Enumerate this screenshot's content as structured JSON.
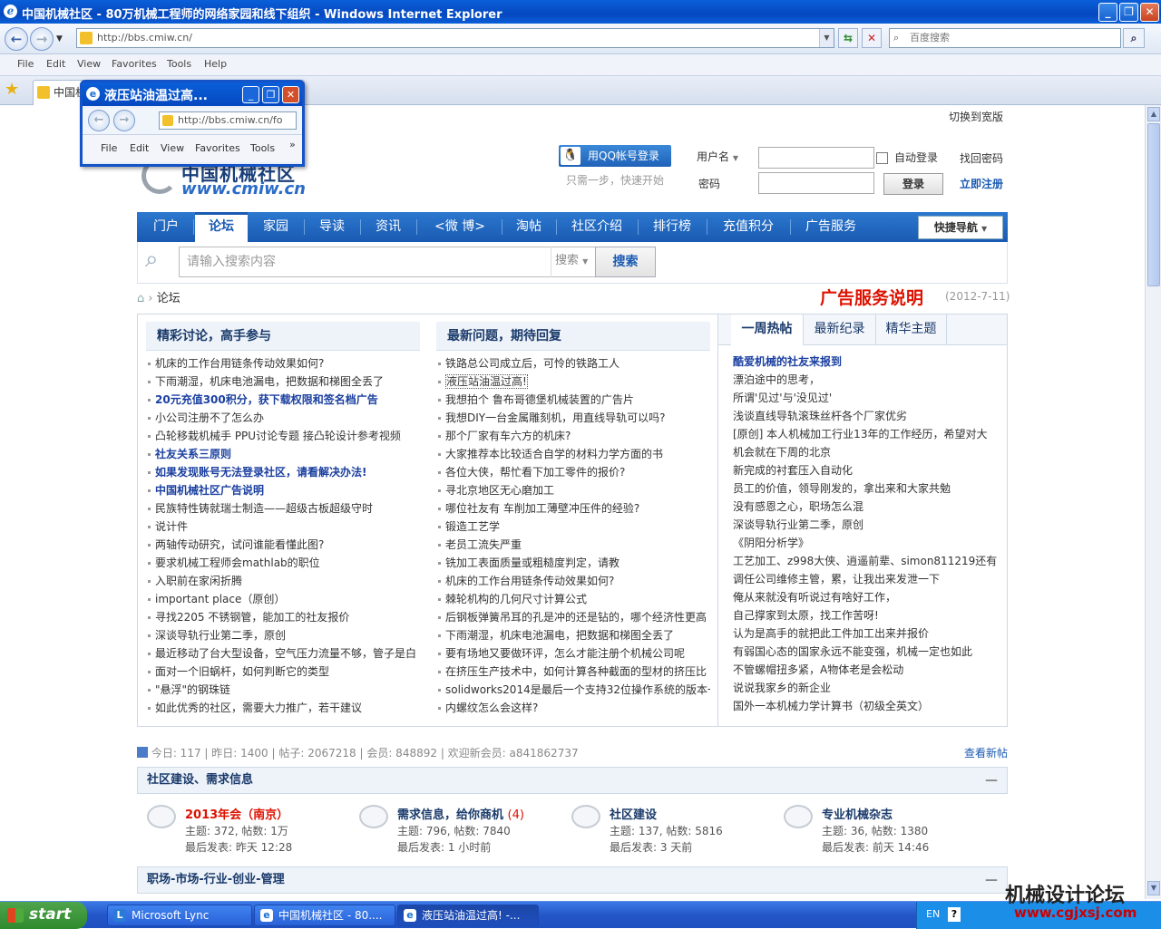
{
  "window": {
    "title": "中国机械社区 - 80万机械工程师的网络家园和线下组织 - Windows Internet Explorer"
  },
  "browser": {
    "address": "http://bbs.cmiw.cn/",
    "search_placeholder": "百度搜索",
    "menu": [
      "File",
      "Edit",
      "View",
      "Favorites",
      "Tools",
      "Help"
    ],
    "tab_label": "中国机"
  },
  "popup": {
    "title": "液压站油温过高...",
    "address": "http://bbs.cmiw.cn/fo",
    "menu": [
      "File",
      "Edit",
      "View",
      "Favorites",
      "Tools"
    ],
    "more": "»"
  },
  "site": {
    "wide_switch": "切换到宽版",
    "logo_cn": "中国机械社区",
    "logo_url": "www.cmiw.cn",
    "qq_login": "用QQ帐号登录",
    "qq_hint": "只需一步，快速开始",
    "username_label": "用户名",
    "password_label": "密码",
    "auto_login": "自动登录",
    "forgot": "找回密码",
    "login_btn": "登录",
    "register": "立即注册",
    "nav": [
      "门户",
      "论坛",
      "家园",
      "导读",
      "资讯",
      "<微 博>",
      "淘帖",
      "社区介绍",
      "排行榜",
      "充值积分",
      "广告服务"
    ],
    "quick_nav": "快捷导航",
    "search_placeholder": "请输入搜索内容",
    "search_type": "搜索",
    "search_btn": "搜索",
    "breadcrumb": "论坛",
    "ad_title": "广告服务说明",
    "ad_date": "(2012-7-11)"
  },
  "col1": {
    "title": "精彩讨论，高手参与",
    "items": [
      {
        "t": "机床的工作台用链条传动效果如何?",
        "b": false
      },
      {
        "t": "下雨潮湿，机床电池漏电，把数据和梯图全丢了",
        "b": false
      },
      {
        "t": "20元充值300积分，获下载权限和签名档广告",
        "b": true
      },
      {
        "t": "小公司注册不了怎么办",
        "b": false
      },
      {
        "t": "凸轮移栽机械手 PPU讨论专题 接凸轮设计参考视频",
        "b": false
      },
      {
        "t": "社友关系三原则",
        "b": true
      },
      {
        "t": "如果发现账号无法登录社区，请看解决办法!",
        "b": true
      },
      {
        "t": "中国机械社区广告说明",
        "b": true
      },
      {
        "t": "民族特性铸就瑞士制造——超级古板超级守时",
        "b": false
      },
      {
        "t": "说计件",
        "b": false
      },
      {
        "t": "两轴传动研究，试问谁能看懂此图?",
        "b": false
      },
      {
        "t": "要求机械工程师会mathlab的职位",
        "b": false
      },
      {
        "t": "入职前在家闲折腾",
        "b": false
      },
      {
        "t": "important place（原创）",
        "b": false
      },
      {
        "t": "寻找2205 不锈钢管，能加工的社友报价",
        "b": false
      },
      {
        "t": "深谈导轨行业第二季，原创",
        "b": false
      },
      {
        "t": "最近移动了台大型设备，空气压力流量不够，管子是白",
        "b": false
      },
      {
        "t": "面对一个旧蜗杆，如何判断它的类型",
        "b": false
      },
      {
        "t": "\"悬浮\"的钢珠链",
        "b": false
      },
      {
        "t": "如此优秀的社区，需要大力推广，若干建议",
        "b": false
      }
    ]
  },
  "col2": {
    "title": "最新问题，期待回复",
    "items": [
      {
        "t": "铁路总公司成立后，可怜的铁路工人",
        "u": false
      },
      {
        "t": "液压站油温过高!",
        "u": true
      },
      {
        "t": "我想拍个 鲁布哥德堡机械装置的广告片",
        "u": false
      },
      {
        "t": "我想DIY一台金属雕刻机，用直线导轨可以吗?",
        "u": false
      },
      {
        "t": "那个厂家有车六方的机床?",
        "u": false
      },
      {
        "t": "大家推荐本比较适合自学的材料力学方面的书",
        "u": false
      },
      {
        "t": "各位大侠，帮忙看下加工零件的报价?",
        "u": false
      },
      {
        "t": "寻北京地区无心磨加工",
        "u": false
      },
      {
        "t": "哪位社友有 车削加工薄壁冲压件的经验?",
        "u": false
      },
      {
        "t": "锻造工艺学",
        "u": false
      },
      {
        "t": "老员工流失严重",
        "u": false
      },
      {
        "t": "铣加工表面质量或粗糙度判定，请教",
        "u": false
      },
      {
        "t": "机床的工作台用链条传动效果如何?",
        "u": false
      },
      {
        "t": "棘轮机构的几何尺寸计算公式",
        "u": false
      },
      {
        "t": "后钢板弹簧吊耳的孔是冲的还是钻的，哪个经济性更高",
        "u": false
      },
      {
        "t": "下雨潮湿，机床电池漏电，把数据和梯图全丢了",
        "u": false
      },
      {
        "t": "要有场地又要做环评，怎么才能注册个机械公司呢",
        "u": false
      },
      {
        "t": "在挤压生产技术中，如何计算各种截面的型材的挤压比",
        "u": false
      },
      {
        "t": "solidworks2014是最后一个支持32位操作系统的版本一",
        "u": false
      },
      {
        "t": "内螺纹怎么会这样?",
        "u": false
      }
    ]
  },
  "right": {
    "tabs": [
      "一周热帖",
      "最新纪录",
      "精华主题"
    ],
    "items": [
      {
        "t": "酷爱机械的社友来报到",
        "b": true
      },
      {
        "t": "漂泊途中的思考，",
        "b": false
      },
      {
        "t": "所谓'见过'与'没见过'",
        "b": false
      },
      {
        "t": "浅谈直线导轨滚珠丝杆各个厂家优劣",
        "b": false
      },
      {
        "t": "[原创] 本人机械加工行业13年的工作经历，希望对大",
        "b": false
      },
      {
        "t": "机会就在下周的北京",
        "b": false
      },
      {
        "t": "新完成的衬套压入自动化",
        "b": false
      },
      {
        "t": "员工的价值，领导刚发的，拿出来和大家共勉",
        "b": false
      },
      {
        "t": "没有感恩之心，职场怎么混",
        "b": false
      },
      {
        "t": "深谈导轨行业第二季，原创",
        "b": false
      },
      {
        "t": "《阴阳分析学》",
        "b": false
      },
      {
        "t": "工艺加工、z998大侠、逍遥前辈、simon811219还有",
        "b": false
      },
      {
        "t": "调任公司维修主管，累，让我出来发泄一下",
        "b": false
      },
      {
        "t": "俺从来就没有听说过有啥好工作，",
        "b": false
      },
      {
        "t": "自己撑家到太原，找工作苦呀!",
        "b": false
      },
      {
        "t": "认为是高手的就把此工件加工出来并报价",
        "b": false
      },
      {
        "t": "有弱国心态的国家永远不能变强，机械一定也如此",
        "b": false
      },
      {
        "t": "不管螺帽扭多紧，A物体老是会松动",
        "b": false
      },
      {
        "t": "说说我家乡的新企业",
        "b": false
      },
      {
        "t": "国外一本机械力学计算书（初级全英文）",
        "b": false
      }
    ]
  },
  "stats": {
    "today": "今日: 117",
    "yesterday": "昨日: 1400",
    "posts": "帖子: 2067218",
    "members": "会员: 848892",
    "welcome": "欢迎新会员: a841862737",
    "new_posts": "查看新帖"
  },
  "sections": [
    {
      "title": "社区建设、需求信息",
      "collapse": "—"
    },
    {
      "title": "职场-市场-行业-创业-管理",
      "collapse": "—"
    }
  ],
  "forums": [
    {
      "name": "2013年会（南京）",
      "count": "",
      "stat": "主题: 372, 帖数: 1万",
      "last": "最后发表: 昨天 12:28"
    },
    {
      "name": "需求信息，给你商机",
      "count": "(4)",
      "stat": "主题: 796, 帖数: 7840",
      "last": "最后发表: 1 小时前"
    },
    {
      "name": "社区建设",
      "count": "",
      "stat": "主题: 137, 帖数: 5816",
      "last": "最后发表: 3 天前"
    },
    {
      "name": "专业机械杂志",
      "count": "",
      "stat": "主题: 36, 帖数: 1380",
      "last": "最后发表: 前天 14:46"
    }
  ],
  "taskbar": {
    "start": "start",
    "tasks": [
      "Microsoft Lync",
      "中国机械社区 - 80....",
      "液压站油温过高! -..."
    ],
    "lang": "EN",
    "help": "?"
  },
  "watermark": {
    "line1": "机械设计论坛",
    "line2": "www.cgjxsj.com"
  }
}
